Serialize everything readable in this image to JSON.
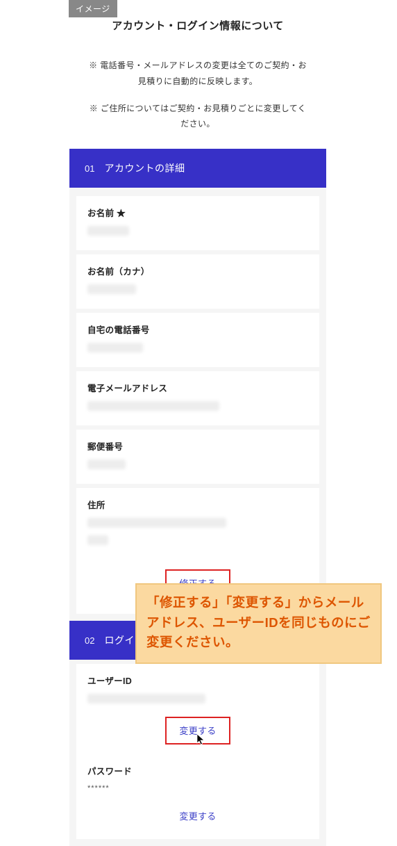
{
  "badge": "イメージ",
  "title": "アカウント・ログイン情報について",
  "notices": [
    "※ 電話番号・メールアドレスの変更は全てのご契約・お見積りに自動的に反映します。",
    "※ ご住所についてはご契約・お見積りごとに変更してください。"
  ],
  "section1": {
    "number": "01",
    "title": "アカウントの詳細",
    "fields": [
      {
        "label": "お名前 ★",
        "valueWidth": 60
      },
      {
        "label": "お名前（カナ）",
        "valueWidth": 70
      },
      {
        "label": "自宅の電話番号",
        "valueWidth": 80
      },
      {
        "label": "電子メールアドレス",
        "valueWidth": 190
      },
      {
        "label": "郵便番号",
        "valueWidth": 55
      },
      {
        "label": "住所",
        "valueWidth": 200,
        "line2Width": 30
      }
    ],
    "action": "修正する"
  },
  "section2": {
    "number": "02",
    "title": "ログイ",
    "userId": {
      "label": "ユーザーID",
      "valueWidth": 170,
      "action": "変更する"
    },
    "password": {
      "label": "パスワード",
      "value": "******",
      "action": "変更する"
    }
  },
  "callout": "「修正する」「変更する」からメールアドレス、ユーザーIDを同じものにご変更ください。"
}
